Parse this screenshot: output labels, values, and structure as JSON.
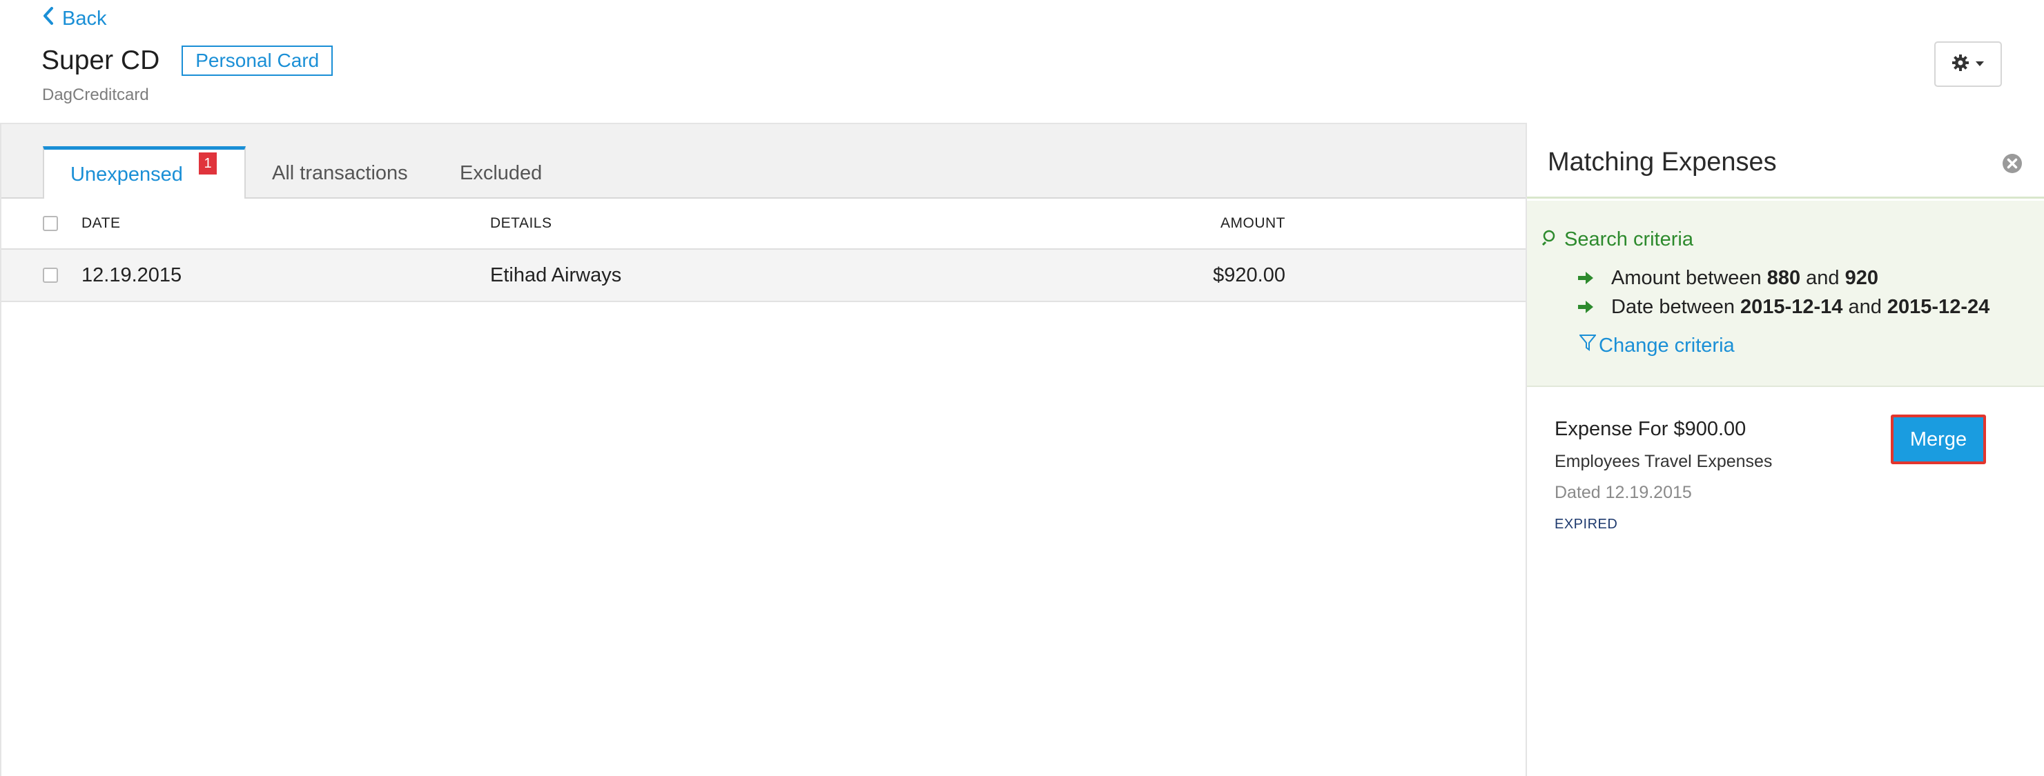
{
  "header": {
    "back_label": "Back",
    "title": "Super CD",
    "card_type_badge": "Personal Card",
    "subtitle": "DagCreditcard",
    "settings_icon": "gear-icon"
  },
  "tabs": [
    {
      "label": "Unexpensed",
      "badge": "1",
      "active": true
    },
    {
      "label": "All transactions",
      "active": false
    },
    {
      "label": "Excluded",
      "active": false
    }
  ],
  "table": {
    "columns": {
      "date": "DATE",
      "details": "DETAILS",
      "amount": "AMOUNT"
    },
    "rows": [
      {
        "date": "12.19.2015",
        "details": "Etihad Airways",
        "amount": "$920.00"
      }
    ]
  },
  "matching_panel": {
    "title": "Matching Expenses",
    "search_criteria_label": "Search criteria",
    "criteria": {
      "amount_prefix": "Amount between",
      "amount_min": "880",
      "amount_and": "and",
      "amount_max": "920",
      "date_prefix": "Date between",
      "date_from": "2015-12-14",
      "date_and": "and",
      "date_to": "2015-12-24"
    },
    "change_criteria_label": "Change criteria",
    "expense": {
      "title": "Expense For $900.00",
      "category": "Employees Travel Expenses",
      "date": "Dated 12.19.2015",
      "status": "EXPIRED"
    },
    "merge_label": "Merge"
  },
  "colors": {
    "accent": "#1a8fd6",
    "badge_red": "#e0343c",
    "criteria_green": "#2d8a2d",
    "merge_button": "#1a9ce0",
    "merge_highlight_border": "#e2362e"
  }
}
